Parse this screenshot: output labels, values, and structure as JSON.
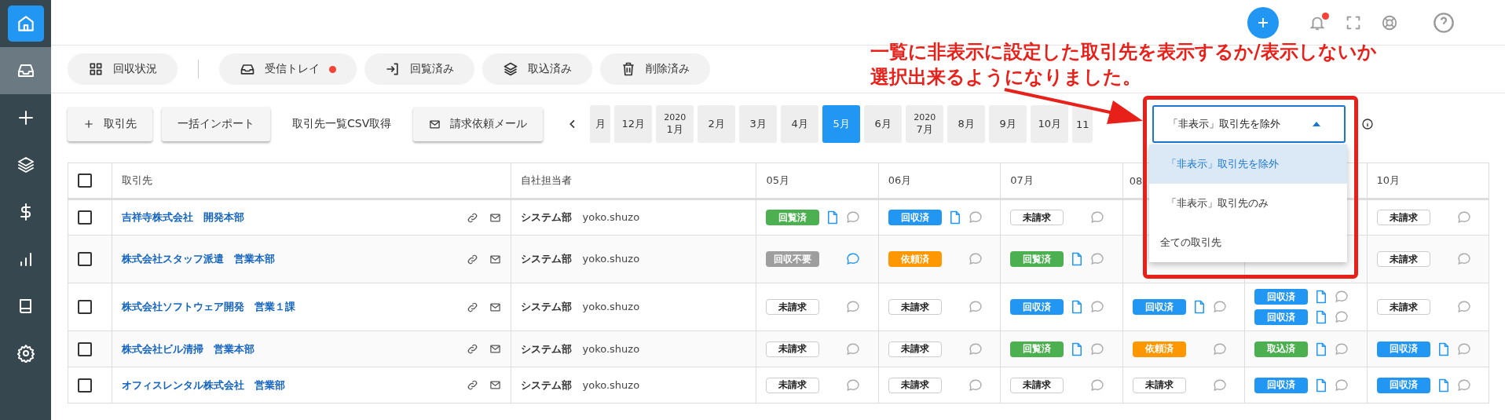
{
  "sidebar": [
    {
      "selected": true,
      "highlighted": false
    },
    {
      "selected": false,
      "highlighted": true
    },
    {
      "selected": false,
      "highlighted": false
    },
    {
      "selected": false,
      "highlighted": false
    },
    {
      "selected": false,
      "highlighted": false
    },
    {
      "selected": false,
      "highlighted": false
    },
    {
      "selected": false,
      "highlighted": false
    },
    {
      "selected": false,
      "highlighted": false
    }
  ],
  "header_icons": [
    {
      "kind": "add"
    },
    {
      "kind": "bell",
      "badge": true
    },
    {
      "kind": "expand"
    },
    {
      "kind": "support"
    },
    {
      "kind": "help"
    }
  ],
  "tabs": [
    {
      "label": "回収状況",
      "selected": false,
      "badge": false
    },
    {
      "label": "受信トレイ",
      "selected": false,
      "badge": true
    },
    {
      "label": "回覧済み",
      "selected": false,
      "badge": false
    },
    {
      "label": "取込済み",
      "selected": false,
      "badge": false
    },
    {
      "label": "削除済み",
      "selected": false,
      "badge": false
    }
  ],
  "toolbar": [
    {
      "label": "取引先",
      "kind": "raised"
    },
    {
      "label": "一括インポート",
      "kind": "raised"
    },
    {
      "label": "取引先一覧CSV取得",
      "kind": "flat"
    },
    {
      "label": "請求依頼メール",
      "kind": "raised"
    }
  ],
  "months": [
    {
      "label": "月",
      "selected": false
    },
    {
      "label": "12月",
      "selected": false
    },
    {
      "year": "2020",
      "label": "1月",
      "selected": false
    },
    {
      "label": "2月",
      "selected": false
    },
    {
      "label": "3月",
      "selected": false
    },
    {
      "label": "4月",
      "selected": false
    },
    {
      "label": "5月",
      "selected": true
    },
    {
      "label": "6月",
      "selected": false
    },
    {
      "year": "2020",
      "label": "7月",
      "selected": false
    },
    {
      "label": "8月",
      "selected": false
    },
    {
      "label": "9月",
      "selected": false
    },
    {
      "label": "10月",
      "selected": false
    },
    {
      "label": "11",
      "selected": false
    }
  ],
  "filter": {
    "value": "「非表示」取引先を除外",
    "expanded": true,
    "options": [
      {
        "label": "「非表示」取引先を除外",
        "selected": true
      },
      {
        "label": "「非表示」取引先のみ",
        "selected": false
      },
      {
        "label": "全ての取引先",
        "selected": false
      }
    ]
  },
  "annotation": {
    "lines": [
      "一覧に非表示に設定した取引先を表示するか/表示しないか",
      "選択出来るようになりました。"
    ]
  },
  "table": {
    "all_checked": false,
    "columns": [
      "取引先",
      "自社担当者"
    ],
    "month_columns": [
      {
        "label": "05月"
      },
      {
        "label": "06月"
      },
      {
        "label": "07月"
      },
      {
        "label": "08"
      },
      {},
      {
        "label": "10月"
      }
    ],
    "rows": [
      {
        "checked": false,
        "name": "吉祥寺株式会社　開発本部",
        "dept": "システム部",
        "user": "yoko.shuzo",
        "months": {
          "m05": {
            "entries": [
              {
                "kind": "filled",
                "label": "回覧済",
                "color": "#4caf50",
                "doc": true,
                "comment_active": false
              }
            ]
          },
          "m06": {
            "entries": [
              {
                "kind": "filled",
                "label": "回収済",
                "color": "#2196f3",
                "doc": true,
                "comment_active": false
              }
            ]
          },
          "m07": {
            "entries": [
              {
                "kind": "outline",
                "label": "未請求",
                "comment_active": false
              }
            ]
          },
          "m10": {
            "entries": [
              {
                "kind": "outline",
                "label": "未請求",
                "comment_active": false
              }
            ]
          }
        }
      },
      {
        "checked": false,
        "name": "株式会社スタッフ派遣　営業本部",
        "dept": "システム部",
        "user": "yoko.shuzo",
        "months": {
          "m05": {
            "entries": [
              {
                "kind": "filled",
                "label": "回収不要",
                "color": "#9e9e9e",
                "comment_active": true
              }
            ]
          },
          "m06": {
            "entries": [
              {
                "kind": "filled",
                "label": "依頼済",
                "color": "#ff9800",
                "comment_active": false
              }
            ]
          },
          "m07": {
            "entries": [
              {
                "kind": "filled",
                "label": "回覧済",
                "color": "#4caf50",
                "doc": true,
                "comment_active": false
              }
            ]
          },
          "m10": {
            "entries": [
              {
                "kind": "outline",
                "label": "未請求",
                "comment_active": false
              }
            ]
          }
        }
      },
      {
        "checked": false,
        "name": "株式会社ソフトウェア開発　営業１課",
        "dept": "システム部",
        "user": "yoko.shuzo",
        "months": {
          "m05": {
            "entries": [
              {
                "kind": "outline",
                "label": "未請求",
                "comment_active": false
              }
            ]
          },
          "m06": {
            "entries": [
              {
                "kind": "outline",
                "label": "未請求",
                "comment_active": false
              }
            ]
          },
          "m07": {
            "entries": [
              {
                "kind": "filled",
                "label": "回収済",
                "color": "#2196f3",
                "doc": true,
                "comment_active": false
              }
            ]
          },
          "m08": {
            "entries": [
              {
                "kind": "filled",
                "label": "回収済",
                "color": "#2196f3",
                "doc": true,
                "comment_active": false
              }
            ]
          },
          "m09": {
            "entries": [
              {
                "kind": "filled",
                "label": "回収済",
                "color": "#2196f3",
                "doc": true,
                "comment_active": false
              },
              {
                "kind": "filled",
                "label": "回収済",
                "color": "#2196f3",
                "doc": true,
                "comment_active": false
              }
            ]
          },
          "m10": {
            "entries": [
              {
                "kind": "outline",
                "label": "未請求",
                "comment_active": false
              }
            ]
          }
        }
      },
      {
        "checked": false,
        "name": "株式会社ビル清掃　営業本部",
        "dept": "システム部",
        "user": "yoko.shuzo",
        "months": {
          "m05": {
            "entries": [
              {
                "kind": "outline",
                "label": "未請求",
                "comment_active": false
              }
            ]
          },
          "m06": {
            "entries": [
              {
                "kind": "outline",
                "label": "未請求",
                "comment_active": false
              }
            ]
          },
          "m07": {
            "entries": [
              {
                "kind": "filled",
                "label": "回覧済",
                "color": "#4caf50",
                "doc": true,
                "comment_active": false
              }
            ]
          },
          "m08": {
            "entries": [
              {
                "kind": "filled",
                "label": "依頼済",
                "color": "#ff9800",
                "comment_active": false
              }
            ]
          },
          "m09": {
            "entries": [
              {
                "kind": "filled",
                "label": "取込済",
                "color": "#4caf50",
                "doc": true,
                "comment_active": false
              }
            ]
          },
          "m10": {
            "entries": [
              {
                "kind": "filled",
                "label": "回収済",
                "color": "#2196f3",
                "doc": true,
                "comment_active": false
              }
            ]
          }
        }
      },
      {
        "checked": false,
        "name": "オフィスレンタル株式会社　営業部",
        "dept": "システム部",
        "user": "yoko.shuzo",
        "months": {
          "m05": {
            "entries": [
              {
                "kind": "outline",
                "label": "未請求",
                "comment_active": false
              }
            ]
          },
          "m06": {
            "entries": [
              {
                "kind": "outline",
                "label": "未請求",
                "comment_active": false
              }
            ]
          },
          "m07": {
            "entries": [
              {
                "kind": "outline",
                "label": "未請求",
                "comment_active": false
              }
            ]
          },
          "m08": {
            "entries": [
              {
                "kind": "outline",
                "label": "未請求",
                "comment_active": false
              }
            ]
          },
          "m09": {
            "entries": [
              {
                "kind": "filled",
                "label": "回収済",
                "color": "#2196f3",
                "doc": true,
                "comment_active": false
              }
            ]
          },
          "m10": {
            "entries": [
              {
                "kind": "filled",
                "label": "回収済",
                "color": "#2196f3",
                "doc": true,
                "comment_active": false
              }
            ]
          }
        }
      }
    ]
  }
}
